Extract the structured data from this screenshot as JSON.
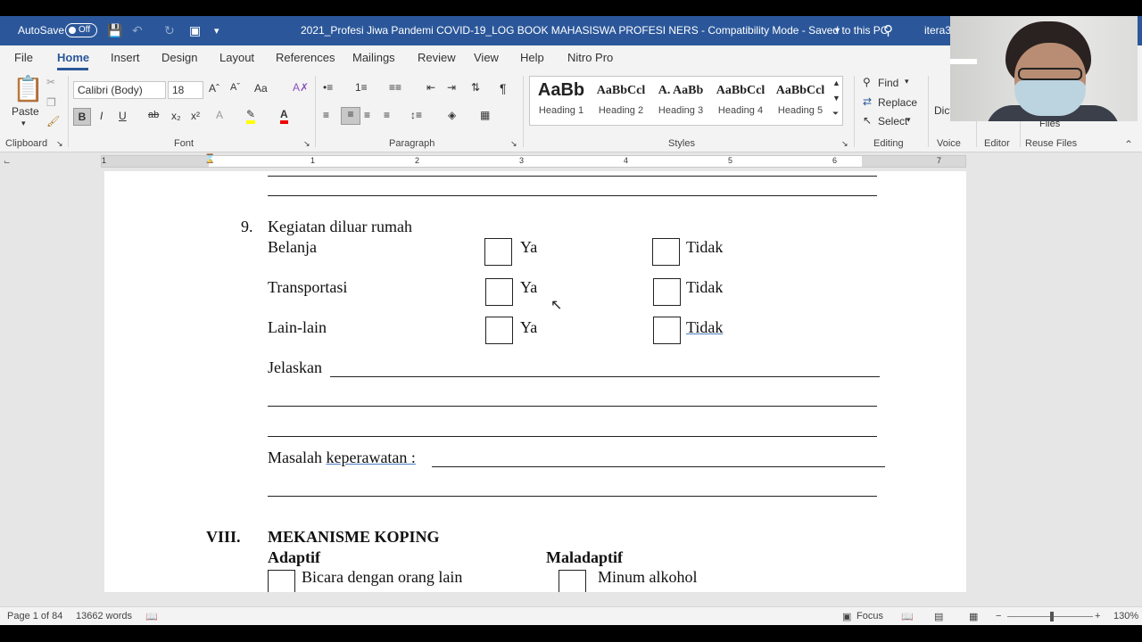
{
  "titlebar": {
    "autosave_label": "AutoSave",
    "autosave_state": "Off",
    "document_title": "2021_Profesi Jiwa Pandemi COVID-19_LOG BOOK MAHASISWA PROFESI NERS  -  Compatibility Mode  -  Saved to this PC",
    "user_fragment": "itera3"
  },
  "menu": {
    "tabs": [
      "File",
      "Home",
      "Insert",
      "Design",
      "Layout",
      "References",
      "Mailings",
      "Review",
      "View",
      "Help",
      "Nitro Pro"
    ],
    "active": "Home"
  },
  "ribbon": {
    "clipboard": {
      "paste": "Paste",
      "label": "Clipboard"
    },
    "font": {
      "name": "Calibri (Body)",
      "size": "18",
      "case": "Aa",
      "label": "Font",
      "bold": "B",
      "italic": "I",
      "underline": "U",
      "strike": "ab",
      "sub": "x₂",
      "sup": "x²"
    },
    "paragraph": {
      "label": "Paragraph"
    },
    "styles": {
      "label": "Styles",
      "items": [
        {
          "sample": "AaBb",
          "name": "Heading 1"
        },
        {
          "sample": "AaBbCcl",
          "name": "Heading 2"
        },
        {
          "sample": "A. AaBb",
          "name": "Heading 3"
        },
        {
          "sample": "AaBbCcl",
          "name": "Heading 4"
        },
        {
          "sample": "AaBbCcl",
          "name": "Heading 5"
        }
      ]
    },
    "editing": {
      "find": "Find",
      "replace": "Replace",
      "select": "Select",
      "label": "Editing"
    },
    "voice": {
      "dictate_fragment": "Dict",
      "label": "Voice"
    },
    "editor": {
      "label": "Editor"
    },
    "reuse": {
      "files": "Files",
      "label": "Reuse Files"
    }
  },
  "ruler": {
    "numbers": [
      "1",
      "1",
      "2",
      "3",
      "4",
      "5",
      "6",
      "7"
    ]
  },
  "document": {
    "item9": {
      "number": "9.",
      "title": "Kegiatan diluar rumah",
      "rows": [
        {
          "label": "Belanja",
          "yes": "Ya",
          "no": "Tidak"
        },
        {
          "label": "Transportasi",
          "yes": "Ya",
          "no": "Tidak"
        },
        {
          "label": "Lain-lain",
          "yes": "Ya",
          "no": "Tidak"
        }
      ],
      "explain": "Jelaskan",
      "problem_prefix": "Masalah ",
      "problem_word": "keperawatan :"
    },
    "section8": {
      "number": "VIII.",
      "title": "MEKANISME KOPING",
      "adaptive": "Adaptif",
      "maladaptive": "Maladaptif",
      "adaptive_item": "Bicara dengan orang lain",
      "maladaptive_item": "Minum alkohol"
    }
  },
  "statusbar": {
    "page": "Page 1 of 84",
    "words": "13662 words",
    "focus": "Focus",
    "zoom": "130%"
  }
}
